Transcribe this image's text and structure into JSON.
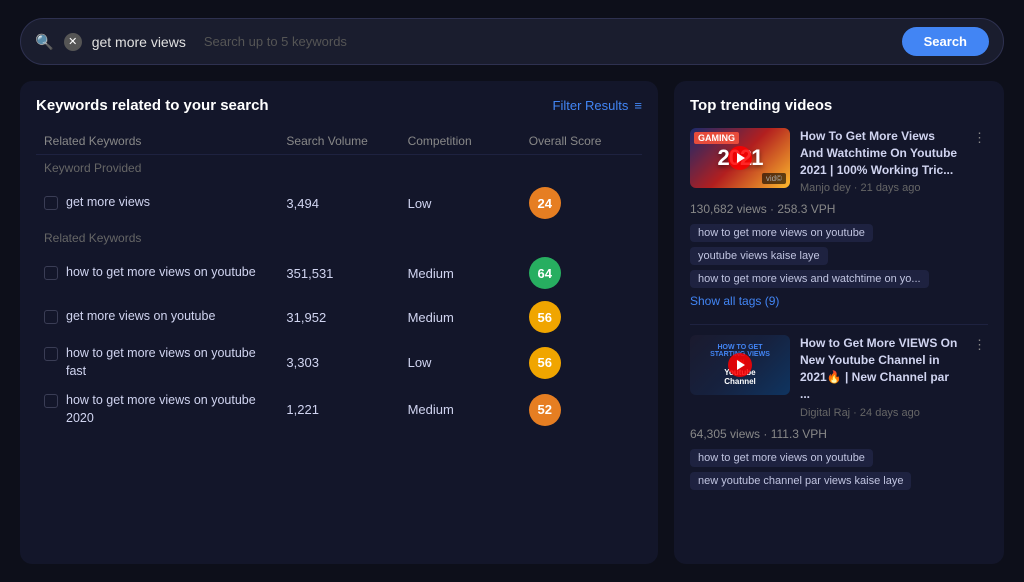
{
  "search": {
    "query": "get more views",
    "placeholder": "Search up to 5 keywords",
    "button_label": "Search"
  },
  "left_panel": {
    "title": "Keywords related to your search",
    "filter_label": "Filter Results",
    "columns": {
      "keyword": "Related Keywords",
      "volume": "Search Volume",
      "competition": "Competition",
      "score": "Overall Score"
    },
    "sections": [
      {
        "label": "Keyword Provided",
        "rows": [
          {
            "keyword": "get more views",
            "volume": "3,494",
            "competition": "Low",
            "score": "24",
            "score_class": "score-orange"
          }
        ]
      },
      {
        "label": "Related Keywords",
        "rows": [
          {
            "keyword": "how to get more views on youtube",
            "volume": "351,531",
            "competition": "Medium",
            "score": "64",
            "score_class": "score-green"
          },
          {
            "keyword": "get more views on youtube",
            "volume": "31,952",
            "competition": "Medium",
            "score": "56",
            "score_class": "score-yellow"
          },
          {
            "keyword": "how to get more views on youtube fast",
            "volume": "3,303",
            "competition": "Low",
            "score": "56",
            "score_class": "score-yellow"
          },
          {
            "keyword": "how to get more views on youtube 2020",
            "volume": "1,221",
            "competition": "Medium",
            "score": "52",
            "score_class": "score-orange"
          }
        ]
      }
    ]
  },
  "right_panel": {
    "title": "Top trending videos",
    "videos": [
      {
        "title": "How To Get More Views And Watchtime On Youtube 2021 | 100% Working Tric...",
        "channel": "Manjo dey",
        "ago": "21 days ago",
        "views": "130,682 views",
        "vph": "258.3 VPH",
        "thumb_type": "gaming",
        "thumb_year": "2021",
        "tags": [
          "how to get more views on youtube",
          "youtube views kaise laye",
          "how to get more views and watchtime on yo..."
        ],
        "show_tags": "Show all tags (9)"
      },
      {
        "title": "How to Get More VIEWS On New Youtube Channel in 2021🔥 | New Channel par ...",
        "channel": "Digital Raj",
        "ago": "24 days ago",
        "views": "64,305 views",
        "vph": "111.3 VPH",
        "thumb_type": "howto",
        "tags": [
          "how to get more views on youtube",
          "new youtube channel par views kaise laye"
        ],
        "show_tags": ""
      }
    ]
  }
}
